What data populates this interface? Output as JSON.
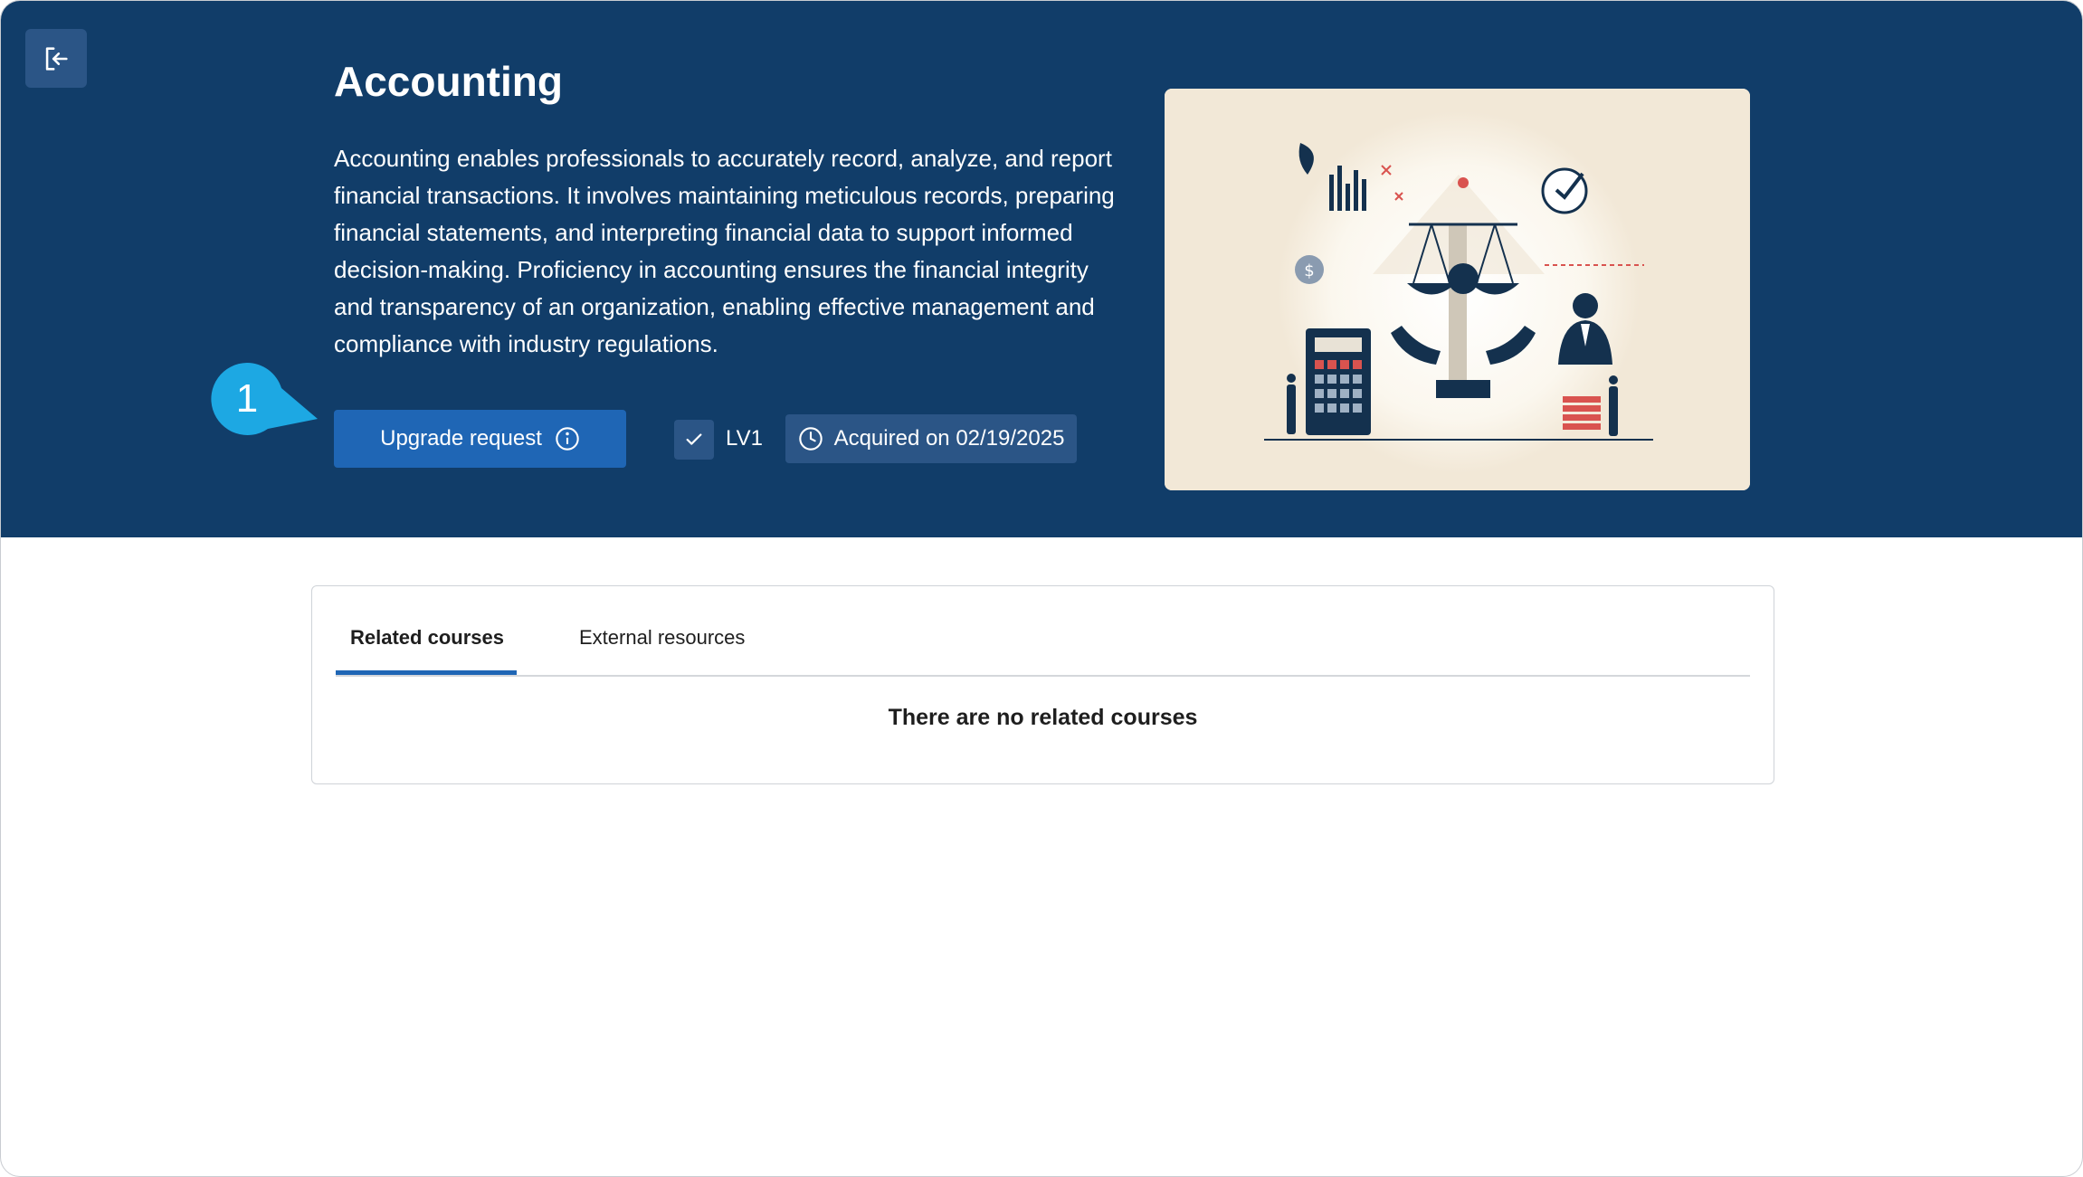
{
  "header": {
    "title": "Accounting",
    "description": "Accounting enables professionals to accurately record, analyze, and report financial transactions. It involves maintaining meticulous records, preparing financial statements, and interpreting financial data to support informed decision-making. Proficiency in accounting ensures the financial integrity and transparency of an organization, enabling effective management and compliance with industry regulations.",
    "exit_icon": "exit-icon"
  },
  "annotation": {
    "number": "1"
  },
  "actions": {
    "upgrade_label": "Upgrade request",
    "upgrade_icon": "info-icon",
    "level_label": "LV1",
    "level_icon": "check-icon",
    "acquired_label": "Acquired on 02/19/2025",
    "acquired_icon": "clock-icon"
  },
  "tabs": [
    {
      "label": "Related courses",
      "active": true
    },
    {
      "label": "External resources",
      "active": false
    }
  ],
  "content": {
    "empty_message": "There are no related courses"
  },
  "colors": {
    "hero_bg": "#113d69",
    "primary": "#1f66b5",
    "chip_bg": "#2b5586",
    "marker": "#1da8e3"
  }
}
